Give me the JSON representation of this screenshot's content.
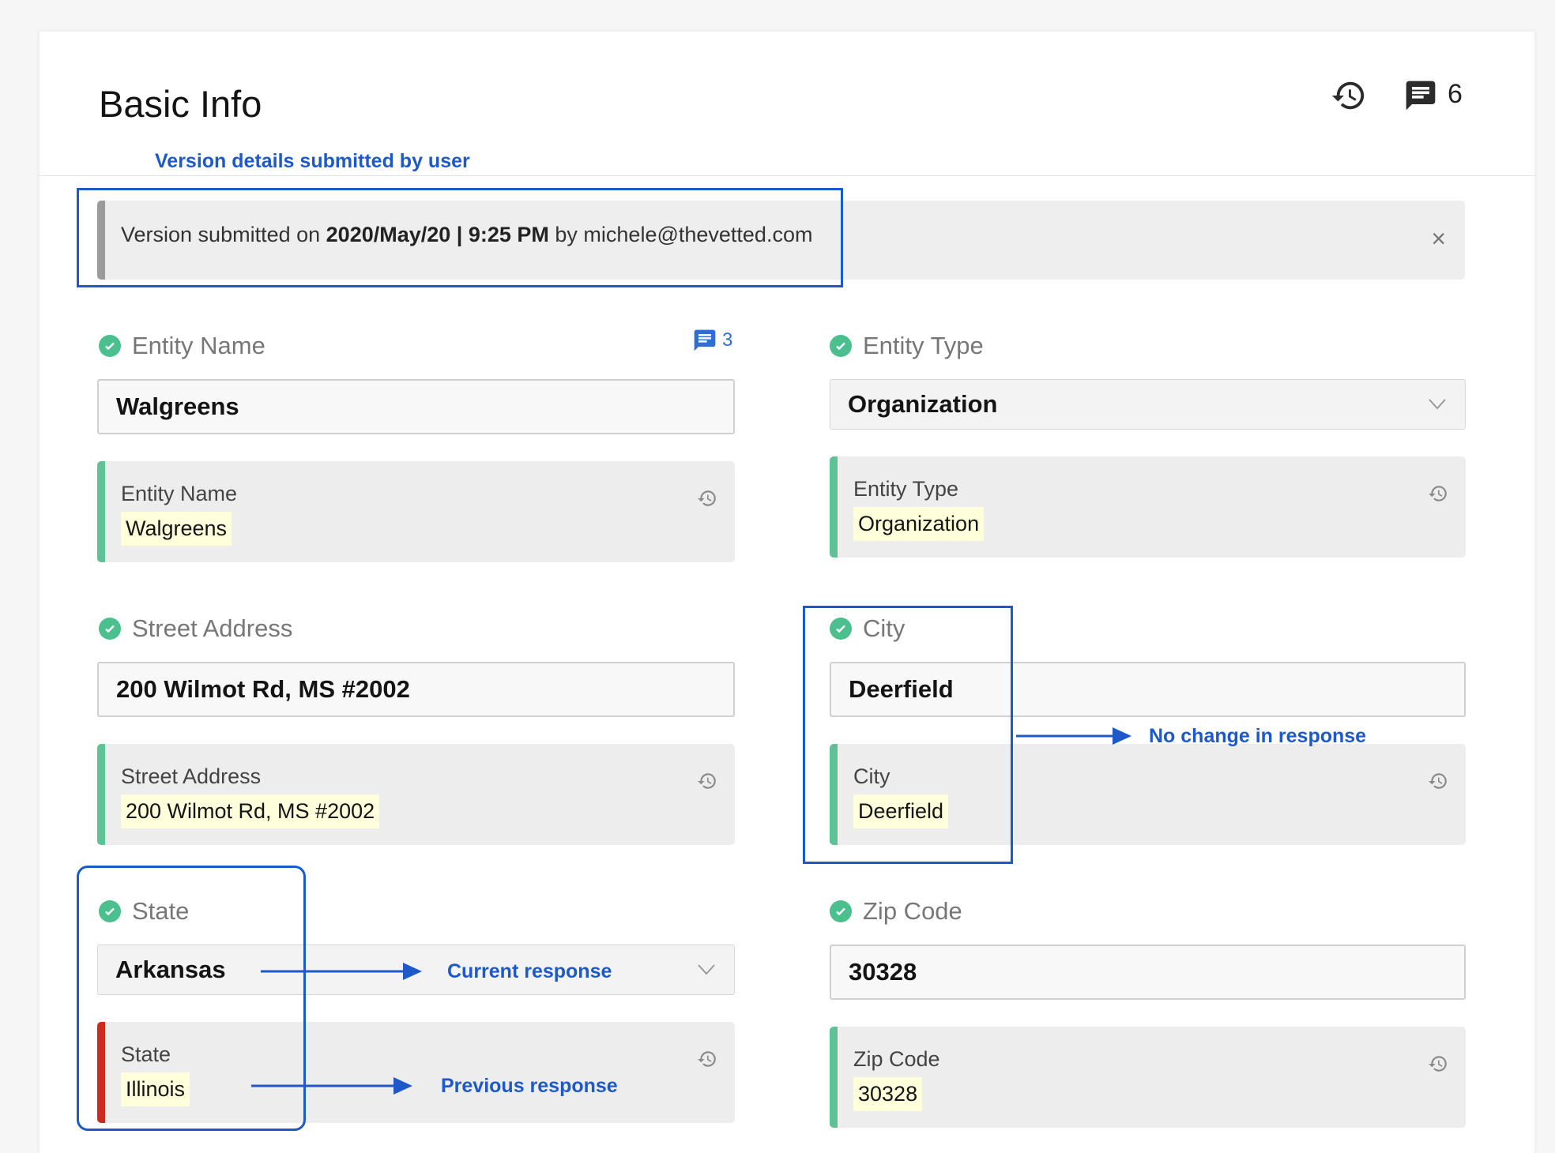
{
  "header": {
    "title": "Basic Info",
    "history_icon": "history-icon",
    "comment_icon": "comment-icon",
    "comment_count": "6"
  },
  "annotations": {
    "version_details": "Version details submitted by user",
    "no_change": "No change in response",
    "current_response": "Current response",
    "previous_response": "Previous response",
    "color": "#1d59c9"
  },
  "banner": {
    "prefix": "Version submitted on ",
    "date_time": "2020/May/20 | 9:25 PM",
    "middle": " by ",
    "user": "michele@thevetted.com",
    "close": "×"
  },
  "fields": {
    "entity_name": {
      "label": "Entity Name",
      "value": "Walgreens",
      "comment_count": "3",
      "prev_label": "Entity Name",
      "prev_value": "Walgreens",
      "status": "unchanged"
    },
    "entity_type": {
      "label": "Entity Type",
      "value": "Organization",
      "prev_label": "Entity Type",
      "prev_value": "Organization",
      "status": "unchanged"
    },
    "street_address": {
      "label": "Street Address",
      "value": "200 Wilmot Rd, MS #2002",
      "prev_label": "Street Address",
      "prev_value": "200 Wilmot Rd, MS #2002",
      "status": "unchanged"
    },
    "city": {
      "label": "City",
      "value": "Deerfield",
      "prev_label": "City",
      "prev_value": "Deerfield",
      "status": "unchanged"
    },
    "state": {
      "label": "State",
      "value": "Arkansas",
      "prev_label": "State",
      "prev_value": "Illinois",
      "status": "changed"
    },
    "zip_code": {
      "label": "Zip Code",
      "value": "30328",
      "prev_label": "Zip Code",
      "prev_value": "30328",
      "status": "unchanged"
    }
  },
  "colors": {
    "unchanged_bar": "#5fc195",
    "changed_bar": "#cc2b22",
    "check": "#4cbf8e",
    "highlight": "#ffffdc"
  }
}
